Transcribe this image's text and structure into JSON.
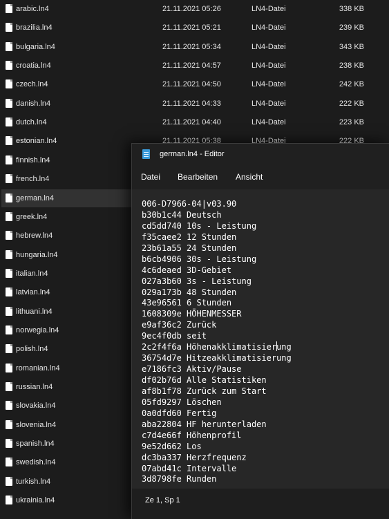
{
  "explorer": {
    "files": [
      {
        "name": "arabic.ln4",
        "date": "21.11.2021 05:26",
        "type": "LN4-Datei",
        "size": "338 KB"
      },
      {
        "name": "brazilia.ln4",
        "date": "21.11.2021 05:21",
        "type": "LN4-Datei",
        "size": "239 KB"
      },
      {
        "name": "bulgaria.ln4",
        "date": "21.11.2021 05:34",
        "type": "LN4-Datei",
        "size": "343 KB"
      },
      {
        "name": "croatia.ln4",
        "date": "21.11.2021 04:57",
        "type": "LN4-Datei",
        "size": "238 KB"
      },
      {
        "name": "czech.ln4",
        "date": "21.11.2021 04:50",
        "type": "LN4-Datei",
        "size": "242 KB"
      },
      {
        "name": "danish.ln4",
        "date": "21.11.2021 04:33",
        "type": "LN4-Datei",
        "size": "222 KB"
      },
      {
        "name": "dutch.ln4",
        "date": "21.11.2021 04:40",
        "type": "LN4-Datei",
        "size": "223 KB"
      },
      {
        "name": "estonian.ln4",
        "date": "21.11.2021 05:38",
        "type": "LN4-Datei",
        "size": "222 KB"
      },
      {
        "name": "finnish.ln4",
        "date": "",
        "type": "",
        "size": ""
      },
      {
        "name": "french.ln4",
        "date": "",
        "type": "",
        "size": ""
      },
      {
        "name": "german.ln4",
        "date": "",
        "type": "",
        "size": "",
        "selected": true
      },
      {
        "name": "greek.ln4",
        "date": "",
        "type": "",
        "size": ""
      },
      {
        "name": "hebrew.ln4",
        "date": "",
        "type": "",
        "size": ""
      },
      {
        "name": "hungaria.ln4",
        "date": "",
        "type": "",
        "size": ""
      },
      {
        "name": "italian.ln4",
        "date": "",
        "type": "",
        "size": ""
      },
      {
        "name": "latvian.ln4",
        "date": "",
        "type": "",
        "size": ""
      },
      {
        "name": "lithuani.ln4",
        "date": "",
        "type": "",
        "size": ""
      },
      {
        "name": "norwegia.ln4",
        "date": "",
        "type": "",
        "size": ""
      },
      {
        "name": "polish.ln4",
        "date": "",
        "type": "",
        "size": ""
      },
      {
        "name": "romanian.ln4",
        "date": "",
        "type": "",
        "size": ""
      },
      {
        "name": "russian.ln4",
        "date": "",
        "type": "",
        "size": ""
      },
      {
        "name": "slovakia.ln4",
        "date": "",
        "type": "",
        "size": ""
      },
      {
        "name": "slovenia.ln4",
        "date": "",
        "type": "",
        "size": ""
      },
      {
        "name": "spanish.ln4",
        "date": "",
        "type": "",
        "size": ""
      },
      {
        "name": "swedish.ln4",
        "date": "",
        "type": "",
        "size": ""
      },
      {
        "name": "turkish.ln4",
        "date": "",
        "type": "",
        "size": ""
      },
      {
        "name": "ukrainia.ln4",
        "date": "",
        "type": "",
        "size": ""
      }
    ]
  },
  "editor": {
    "title": "german.ln4 - Editor",
    "app_icon": "notepad-icon",
    "menu": [
      "Datei",
      "Bearbeiten",
      "Ansicht"
    ],
    "lines": [
      "006-D7966-04|v03.90",
      "b30b1c44 Deutsch",
      "cd5dd740 10s - Leistung",
      "f35caee2 12 Stunden",
      "23b61a55 24 Stunden",
      "b6cb4906 30s - Leistung",
      "4c6deaed 3D-Gebiet",
      "027a3b60 3s - Leistung",
      "029a173b 48 Stunden",
      "43e96561 6 Stunden",
      "1608309e HÖHENMESSER",
      "e9af36c2 Zurück",
      "9ec4f0db seit",
      "2c2f4f6a Höhenakklimatisierung",
      "36754d7e Hitzeakklimatisierung",
      "e7186fc3 Aktiv/Pause",
      "df02b76d Alle Statistiken",
      "af8b1f78 Zurück zum Start",
      "05fd9297 Löschen",
      "0a0dfd60 Fertig",
      "aba22804 HF herunterladen",
      "c7d4e66f Höhenprofil",
      "9e52d662 Los",
      "dc3ba337 Herzfrequenz",
      "07abd41c Intervalle",
      "3d8798fe Runden"
    ],
    "status": "Ze 1, Sp 1"
  }
}
